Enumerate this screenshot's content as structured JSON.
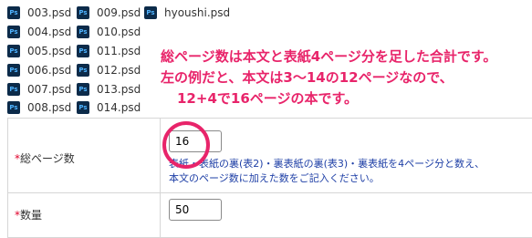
{
  "files": [
    {
      "name": "003.psd"
    },
    {
      "name": "009.psd"
    },
    {
      "name": "hyoushi.psd"
    },
    {
      "name": "004.psd"
    },
    {
      "name": "010.psd"
    },
    {
      "name": "005.psd"
    },
    {
      "name": "011.psd"
    },
    {
      "name": "006.psd"
    },
    {
      "name": "012.psd"
    },
    {
      "name": "007.psd"
    },
    {
      "name": "013.psd"
    },
    {
      "name": "008.psd"
    },
    {
      "name": "014.psd"
    }
  ],
  "file_icon_label": "Ps",
  "annotation": {
    "line1": "総ページ数は本文と表紙4ページ分を足した合計です。",
    "line2": "左の例だと、本文は3～14の12ページなので、",
    "line3": "12+4で16ページの本です。"
  },
  "form": {
    "required_mark": "*",
    "pages": {
      "label": "総ページ数",
      "value": "16",
      "note_line1": "表紙・表紙の裏(表2)・裏表紙の裏(表3)・裏表紙を4ページ分と数え、",
      "note_line2": "本文のページ数に加えた数をご記入ください。"
    },
    "quantity": {
      "label": "数量",
      "value": "50"
    }
  },
  "colors": {
    "annotation": "#e8246a",
    "note": "#1e3fa6",
    "required": "#e0002a",
    "ps_icon_bg": "#0c2b4a",
    "ps_icon_text": "#4fb3ff"
  }
}
